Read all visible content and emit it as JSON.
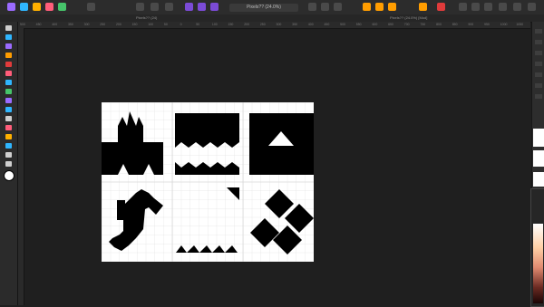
{
  "document": {
    "title": "Pixels?? (24.0%)"
  },
  "tabs": [
    {
      "label": "Pixels?? (24)"
    },
    {
      "label": "Pixels?? (24.0%) [Mod]"
    }
  ],
  "ruler": {
    "labels": [
      "500",
      "450",
      "400",
      "350",
      "300",
      "250",
      "200",
      "150",
      "100",
      "50",
      "0",
      "50",
      "100",
      "150",
      "200",
      "250",
      "300",
      "350",
      "400",
      "450",
      "500",
      "550",
      "600",
      "650",
      "700",
      "750",
      "800",
      "850",
      "900",
      "950",
      "1000",
      "1050"
    ]
  },
  "colors": {
    "app_bg": "#1f1f1f",
    "panel_bg": "#2b2b2b",
    "canvas_bg": "#ffffff",
    "shape": "#000000",
    "accent_purple": "#7b4bd6",
    "accent_orange": "#ff9d00",
    "accent_red": "#e03b3b"
  },
  "toolbar": {
    "tools": [
      "move-tool",
      "select-tool",
      "crop-tool",
      "paint-brush-tool",
      "pixel-tool",
      "eraser-tool",
      "fill-tool",
      "gradient-tool",
      "clone-tool",
      "dodge-tool",
      "pen-tool",
      "text-tool",
      "shape-tool",
      "view-tool",
      "zoom-tool",
      "eyedropper-tool",
      "color-swatch"
    ]
  }
}
